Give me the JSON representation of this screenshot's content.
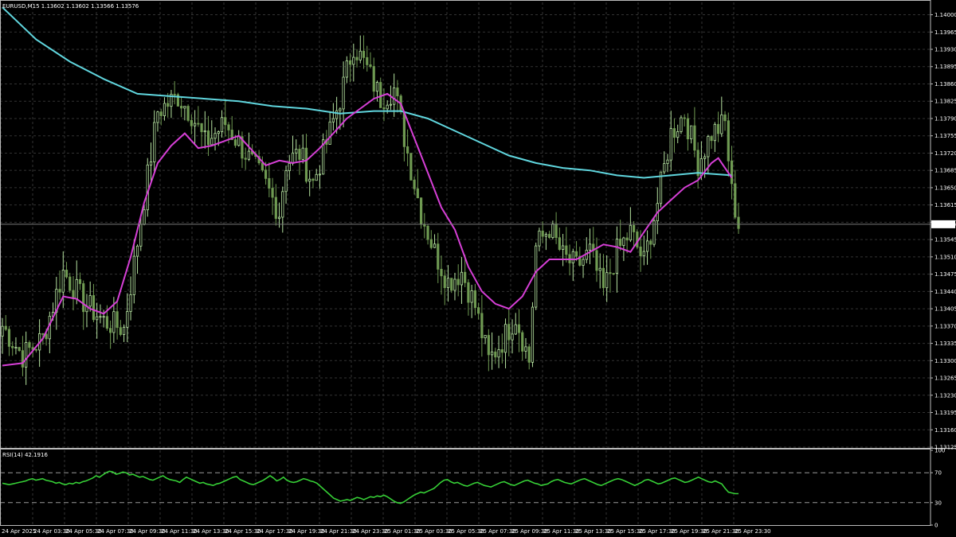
{
  "header": {
    "main": "EURUSD,M15  1.13602 1.13602 1.13566 1.13576",
    "rsi": "RSI(14) 42.1916"
  },
  "colors": {
    "background": "#000000",
    "grid": "#333333",
    "bull_candle": "#b5e2a0",
    "bear_candle": "#6f9a52",
    "ma_fast": "#d63fd6",
    "ma_slow": "#60d6de",
    "rsi": "#36cf36",
    "price_line": "#7a7a7a"
  },
  "chart_data": [
    {
      "type": "candlestick",
      "symbol": "EURUSD",
      "timeframe": "M15",
      "last_price": "1.13576",
      "ylim": [
        1.13125,
        1.14025
      ],
      "yticks": [
        "1.14000",
        "1.13965",
        "1.13930",
        "1.13895",
        "1.13860",
        "1.13825",
        "1.13790",
        "1.13755",
        "1.13720",
        "1.13685",
        "1.13650",
        "1.13615",
        "1.13580",
        "1.13545",
        "1.13510",
        "1.13475",
        "1.13440",
        "1.13405",
        "1.13370",
        "1.13335",
        "1.13300",
        "1.13265",
        "1.13230",
        "1.13195",
        "1.13160",
        "1.13125"
      ],
      "xticks": [
        "24 Apr 2025",
        "24 Apr 03:30",
        "24 Apr 05:30",
        "24 Apr 07:30",
        "24 Apr 09:30",
        "24 Apr 11:30",
        "24 Apr 13:30",
        "24 Apr 15:30",
        "24 Apr 17:30",
        "24 Apr 19:30",
        "24 Apr 21:30",
        "24 Apr 23:30",
        "25 Apr 01:30",
        "25 Apr 03:30",
        "25 Apr 05:30",
        "25 Apr 07:30",
        "25 Apr 09:30",
        "25 Apr 11:30",
        "25 Apr 13:30",
        "25 Apr 15:30",
        "25 Apr 17:30",
        "25 Apr 19:30",
        "25 Apr 21:30",
        "25 Apr 23:30"
      ],
      "close_path": [
        [
          0,
          1.1337
        ],
        [
          6,
          1.1331
        ],
        [
          12,
          1.13345
        ],
        [
          18,
          1.1348
        ],
        [
          24,
          1.1342
        ],
        [
          30,
          1.1338
        ],
        [
          36,
          1.13365
        ],
        [
          40,
          1.1354
        ],
        [
          46,
          1.13805
        ],
        [
          52,
          1.13835
        ],
        [
          56,
          1.138
        ],
        [
          60,
          1.1374
        ],
        [
          66,
          1.1378
        ],
        [
          72,
          1.1372
        ],
        [
          78,
          1.13655
        ],
        [
          82,
          1.136
        ],
        [
          84,
          1.137
        ],
        [
          88,
          1.1372
        ],
        [
          92,
          1.1366
        ],
        [
          96,
          1.1374
        ],
        [
          100,
          1.1383
        ],
        [
          104,
          1.1394
        ],
        [
          108,
          1.1389
        ],
        [
          112,
          1.1383
        ],
        [
          116,
          1.1385
        ],
        [
          120,
          1.1372
        ],
        [
          124,
          1.136
        ],
        [
          128,
          1.1352
        ],
        [
          132,
          1.1346
        ],
        [
          136,
          1.1348
        ],
        [
          140,
          1.1341
        ],
        [
          144,
          1.133
        ],
        [
          148,
          1.1334
        ],
        [
          152,
          1.1339
        ],
        [
          156,
          1.133
        ],
        [
          158,
          1.1353
        ],
        [
          162,
          1.1357
        ],
        [
          166,
          1.1351
        ],
        [
          170,
          1.1349
        ],
        [
          174,
          1.1352
        ],
        [
          178,
          1.1344
        ],
        [
          182,
          1.1352
        ],
        [
          186,
          1.1356
        ],
        [
          190,
          1.135
        ],
        [
          194,
          1.1362
        ],
        [
          198,
          1.1376
        ],
        [
          202,
          1.138
        ],
        [
          206,
          1.137
        ],
        [
          210,
          1.1376
        ],
        [
          214,
          1.1378
        ],
        [
          216,
          1.1364
        ],
        [
          218,
          1.13576
        ]
      ],
      "series": [
        {
          "name": "MA fast",
          "points": [
            [
              0,
              1.1329
            ],
            [
              6,
              1.13295
            ],
            [
              12,
              1.13345
            ],
            [
              18,
              1.1343
            ],
            [
              22,
              1.13425
            ],
            [
              26,
              1.13405
            ],
            [
              30,
              1.13395
            ],
            [
              34,
              1.1342
            ],
            [
              38,
              1.1351
            ],
            [
              42,
              1.1362
            ],
            [
              46,
              1.137
            ],
            [
              50,
              1.13735
            ],
            [
              54,
              1.1376
            ],
            [
              58,
              1.1373
            ],
            [
              62,
              1.13735
            ],
            [
              66,
              1.13745
            ],
            [
              70,
              1.13755
            ],
            [
              74,
              1.13725
            ],
            [
              78,
              1.13695
            ],
            [
              82,
              1.13705
            ],
            [
              86,
              1.137
            ],
            [
              90,
              1.13705
            ],
            [
              94,
              1.1373
            ],
            [
              98,
              1.1376
            ],
            [
              102,
              1.1379
            ],
            [
              106,
              1.1381
            ],
            [
              110,
              1.1383
            ],
            [
              114,
              1.1384
            ],
            [
              118,
              1.1382
            ],
            [
              122,
              1.1375
            ],
            [
              126,
              1.1368
            ],
            [
              130,
              1.1361
            ],
            [
              134,
              1.13565
            ],
            [
              138,
              1.1349
            ],
            [
              142,
              1.1344
            ],
            [
              146,
              1.13415
            ],
            [
              150,
              1.13405
            ],
            [
              154,
              1.1343
            ],
            [
              158,
              1.1348
            ],
            [
              162,
              1.13505
            ],
            [
              166,
              1.13505
            ],
            [
              170,
              1.13505
            ],
            [
              174,
              1.1352
            ],
            [
              178,
              1.13535
            ],
            [
              182,
              1.1353
            ],
            [
              186,
              1.1352
            ],
            [
              190,
              1.1356
            ],
            [
              194,
              1.136
            ],
            [
              198,
              1.13625
            ],
            [
              202,
              1.1365
            ],
            [
              206,
              1.13665
            ],
            [
              210,
              1.137
            ],
            [
              212,
              1.1371
            ],
            [
              216,
              1.1367
            ]
          ]
        },
        {
          "name": "MA slow",
          "points": [
            [
              0,
              1.14015
            ],
            [
              10,
              1.1395
            ],
            [
              20,
              1.13905
            ],
            [
              30,
              1.1387
            ],
            [
              40,
              1.1384
            ],
            [
              50,
              1.13835
            ],
            [
              60,
              1.1383
            ],
            [
              70,
              1.13825
            ],
            [
              80,
              1.13815
            ],
            [
              90,
              1.1381
            ],
            [
              100,
              1.138
            ],
            [
              110,
              1.13805
            ],
            [
              118,
              1.13805
            ],
            [
              126,
              1.1379
            ],
            [
              134,
              1.13765
            ],
            [
              142,
              1.1374
            ],
            [
              150,
              1.13715
            ],
            [
              158,
              1.137
            ],
            [
              166,
              1.1369
            ],
            [
              174,
              1.13685
            ],
            [
              182,
              1.13675
            ],
            [
              190,
              1.1367
            ],
            [
              198,
              1.13675
            ],
            [
              206,
              1.1368
            ],
            [
              216,
              1.13675
            ]
          ]
        }
      ]
    },
    {
      "type": "line",
      "name": "RSI(14)",
      "ylim": [
        0,
        100
      ],
      "yticks": [
        "100",
        "70",
        "30",
        "0"
      ],
      "levels": [
        70,
        30
      ],
      "values": [
        56,
        55,
        54,
        55,
        56,
        57,
        58,
        59,
        61,
        62,
        60,
        61,
        62,
        60,
        59,
        58,
        56,
        57,
        55,
        54,
        56,
        55,
        57,
        56,
        58,
        59,
        61,
        63,
        66,
        64,
        67,
        70,
        72,
        71,
        68,
        69,
        71,
        70,
        67,
        68,
        66,
        64,
        65,
        63,
        61,
        60,
        62,
        64,
        66,
        63,
        61,
        60,
        59,
        57,
        61,
        64,
        62,
        60,
        58,
        56,
        57,
        55,
        54,
        53,
        55,
        56,
        58,
        60,
        62,
        64,
        65,
        61,
        59,
        57,
        55,
        54,
        56,
        58,
        60,
        63,
        66,
        63,
        59,
        61,
        64,
        60,
        58,
        57,
        58,
        60,
        62,
        61,
        59,
        58,
        56,
        52,
        48,
        44,
        40,
        36,
        34,
        32,
        33,
        34,
        33,
        35,
        37,
        36,
        34,
        36,
        38,
        37,
        39,
        38,
        40,
        38,
        35,
        32,
        30,
        29,
        31,
        34,
        37,
        40,
        42,
        44,
        43,
        45,
        47,
        49,
        53,
        57,
        60,
        61,
        58,
        56,
        57,
        55,
        53,
        52,
        54,
        56,
        57,
        55,
        53,
        52,
        51,
        53,
        55,
        57,
        58,
        56,
        54,
        53,
        55,
        57,
        59,
        60,
        58,
        56,
        55,
        53,
        54,
        55,
        58,
        60,
        61,
        59,
        57,
        56,
        55,
        57,
        59,
        61,
        62,
        60,
        58,
        56,
        54,
        53,
        55,
        57,
        59,
        61,
        62,
        61,
        59,
        57,
        55,
        53,
        55,
        57,
        60,
        61,
        59,
        57,
        55,
        56,
        58,
        60,
        62,
        63,
        61,
        59,
        57,
        58,
        60,
        62,
        64,
        62,
        60,
        58,
        57,
        59,
        57,
        55,
        49,
        44,
        43,
        42,
        42
      ]
    }
  ]
}
